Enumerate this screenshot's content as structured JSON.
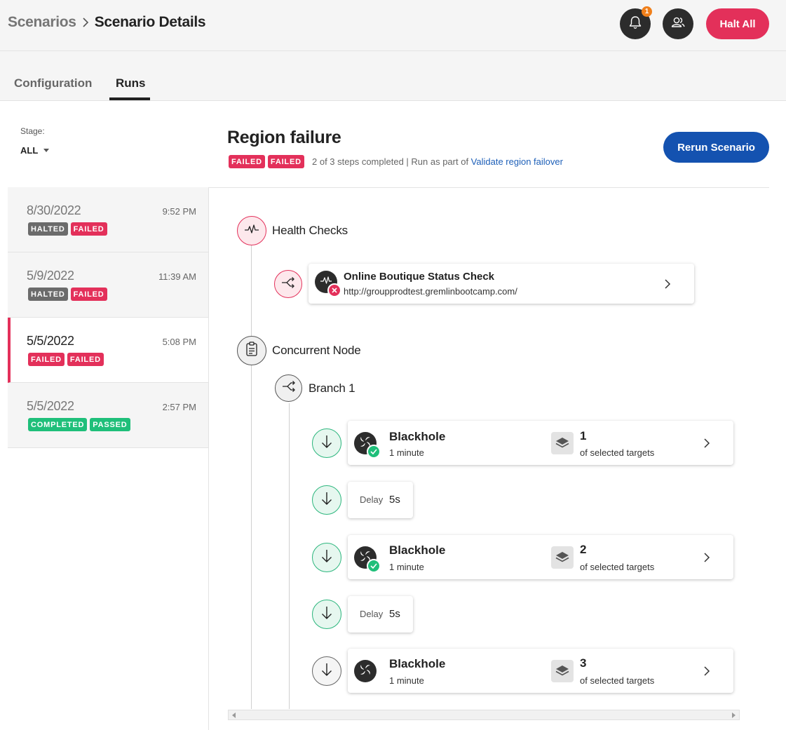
{
  "header": {
    "breadcrumb_root": "Scenarios",
    "breadcrumb_current": "Scenario Details",
    "notification_count": "1",
    "halt_all_label": "Halt All"
  },
  "tabs": [
    {
      "label": "Configuration",
      "active": false
    },
    {
      "label": "Runs",
      "active": true
    }
  ],
  "filter": {
    "stage_label": "Stage:",
    "stage_value": "ALL"
  },
  "scenario": {
    "title": "Region failure",
    "badges": [
      "FAILED",
      "FAILED"
    ],
    "meta_text": "2 of 3 steps completed | Run as part of ",
    "meta_link": "Validate region failover",
    "rerun_label": "Rerun Scenario"
  },
  "runs": [
    {
      "date": "8/30/2022",
      "time": "9:52 PM",
      "badges": [
        "HALTED",
        "FAILED"
      ],
      "selected": false
    },
    {
      "date": "5/9/2022",
      "time": "11:39 AM",
      "badges": [
        "HALTED",
        "FAILED"
      ],
      "selected": false
    },
    {
      "date": "5/5/2022",
      "time": "5:08 PM",
      "badges": [
        "FAILED",
        "FAILED"
      ],
      "selected": true
    },
    {
      "date": "5/5/2022",
      "time": "2:57 PM",
      "badges": [
        "COMPLETED",
        "PASSED"
      ],
      "selected": false
    }
  ],
  "timeline": {
    "health_checks": {
      "label": "Health Checks",
      "check": {
        "title": "Online Boutique Status Check",
        "url": "http://groupprodtest.gremlinbootcamp.com/",
        "status": "failed"
      }
    },
    "concurrent_node": {
      "label": "Concurrent Node",
      "branch_label": "Branch 1",
      "steps": [
        {
          "type": "attack",
          "title": "Blackhole",
          "duration": "1 minute",
          "target_count": "1",
          "target_text": "of selected targets",
          "status": "passed"
        },
        {
          "type": "delay",
          "label": "Delay",
          "value": "5s"
        },
        {
          "type": "attack",
          "title": "Blackhole",
          "duration": "1 minute",
          "target_count": "2",
          "target_text": "of selected targets",
          "status": "passed"
        },
        {
          "type": "delay",
          "label": "Delay",
          "value": "5s"
        },
        {
          "type": "attack",
          "title": "Blackhole",
          "duration": "1 minute",
          "target_count": "3",
          "target_text": "of selected targets",
          "status": "pending"
        }
      ]
    }
  },
  "colors": {
    "brand_red": "#e3305a",
    "brand_blue": "#1452b0",
    "success_green": "#1fbf7a",
    "halted_gray": "#6b6b6b",
    "notification_orange": "#f07f1a"
  }
}
